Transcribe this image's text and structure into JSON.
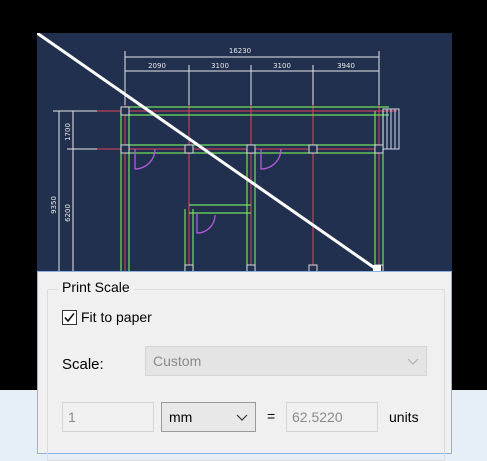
{
  "print_scale": {
    "title": "Print Scale",
    "fit_to_paper": {
      "label": "Fit to paper",
      "checked": true
    },
    "scale": {
      "label": "Scale:",
      "value": "Custom",
      "enabled": false
    },
    "paper_units": {
      "value": "1"
    },
    "unit_select": {
      "value": "mm"
    },
    "equals": "=",
    "drawing_units": {
      "value": "62.5220"
    },
    "units_label": "units"
  },
  "drawing_preview": {
    "total_dimension": "16230",
    "dimensions": [
      "2090",
      "3100",
      "3100",
      "3940"
    ],
    "left_dimensions": [
      "1700",
      "9350",
      "6200"
    ],
    "colors": {
      "background": "#22304f",
      "grid_lines": "#e0425a",
      "walls": "#6fe05a",
      "columns": "#d8d8d8",
      "doors": "#b45bdc",
      "dimensions": "#e6e6e6",
      "diagonal": "#ffffff"
    }
  },
  "icons": {
    "checkbox": "check-icon",
    "dropdown": "chevron-down-icon"
  }
}
